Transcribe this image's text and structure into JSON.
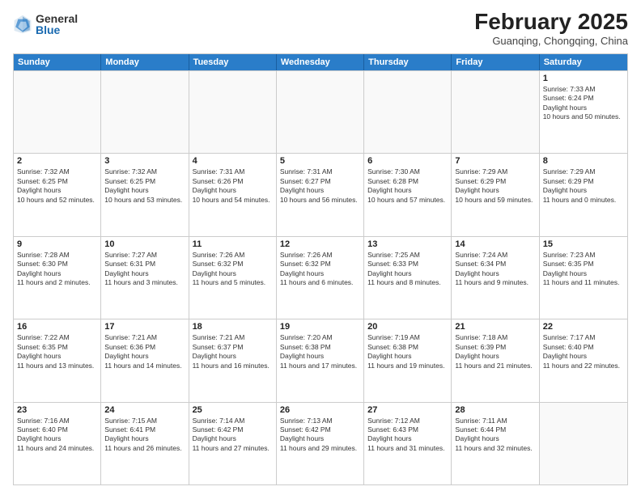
{
  "header": {
    "logo_general": "General",
    "logo_blue": "Blue",
    "main_title": "February 2025",
    "subtitle": "Guanqing, Chongqing, China"
  },
  "weekdays": [
    "Sunday",
    "Monday",
    "Tuesday",
    "Wednesday",
    "Thursday",
    "Friday",
    "Saturday"
  ],
  "weeks": [
    [
      {
        "day": "",
        "empty": true
      },
      {
        "day": "",
        "empty": true
      },
      {
        "day": "",
        "empty": true
      },
      {
        "day": "",
        "empty": true
      },
      {
        "day": "",
        "empty": true
      },
      {
        "day": "",
        "empty": true
      },
      {
        "day": "1",
        "sunrise": "7:33 AM",
        "sunset": "6:24 PM",
        "daylight": "10 hours and 50 minutes."
      }
    ],
    [
      {
        "day": "2",
        "sunrise": "7:32 AM",
        "sunset": "6:25 PM",
        "daylight": "10 hours and 52 minutes."
      },
      {
        "day": "3",
        "sunrise": "7:32 AM",
        "sunset": "6:25 PM",
        "daylight": "10 hours and 53 minutes."
      },
      {
        "day": "4",
        "sunrise": "7:31 AM",
        "sunset": "6:26 PM",
        "daylight": "10 hours and 54 minutes."
      },
      {
        "day": "5",
        "sunrise": "7:31 AM",
        "sunset": "6:27 PM",
        "daylight": "10 hours and 56 minutes."
      },
      {
        "day": "6",
        "sunrise": "7:30 AM",
        "sunset": "6:28 PM",
        "daylight": "10 hours and 57 minutes."
      },
      {
        "day": "7",
        "sunrise": "7:29 AM",
        "sunset": "6:29 PM",
        "daylight": "10 hours and 59 minutes."
      },
      {
        "day": "8",
        "sunrise": "7:29 AM",
        "sunset": "6:29 PM",
        "daylight": "11 hours and 0 minutes."
      }
    ],
    [
      {
        "day": "9",
        "sunrise": "7:28 AM",
        "sunset": "6:30 PM",
        "daylight": "11 hours and 2 minutes."
      },
      {
        "day": "10",
        "sunrise": "7:27 AM",
        "sunset": "6:31 PM",
        "daylight": "11 hours and 3 minutes."
      },
      {
        "day": "11",
        "sunrise": "7:26 AM",
        "sunset": "6:32 PM",
        "daylight": "11 hours and 5 minutes."
      },
      {
        "day": "12",
        "sunrise": "7:26 AM",
        "sunset": "6:32 PM",
        "daylight": "11 hours and 6 minutes."
      },
      {
        "day": "13",
        "sunrise": "7:25 AM",
        "sunset": "6:33 PM",
        "daylight": "11 hours and 8 minutes."
      },
      {
        "day": "14",
        "sunrise": "7:24 AM",
        "sunset": "6:34 PM",
        "daylight": "11 hours and 9 minutes."
      },
      {
        "day": "15",
        "sunrise": "7:23 AM",
        "sunset": "6:35 PM",
        "daylight": "11 hours and 11 minutes."
      }
    ],
    [
      {
        "day": "16",
        "sunrise": "7:22 AM",
        "sunset": "6:35 PM",
        "daylight": "11 hours and 13 minutes."
      },
      {
        "day": "17",
        "sunrise": "7:21 AM",
        "sunset": "6:36 PM",
        "daylight": "11 hours and 14 minutes."
      },
      {
        "day": "18",
        "sunrise": "7:21 AM",
        "sunset": "6:37 PM",
        "daylight": "11 hours and 16 minutes."
      },
      {
        "day": "19",
        "sunrise": "7:20 AM",
        "sunset": "6:38 PM",
        "daylight": "11 hours and 17 minutes."
      },
      {
        "day": "20",
        "sunrise": "7:19 AM",
        "sunset": "6:38 PM",
        "daylight": "11 hours and 19 minutes."
      },
      {
        "day": "21",
        "sunrise": "7:18 AM",
        "sunset": "6:39 PM",
        "daylight": "11 hours and 21 minutes."
      },
      {
        "day": "22",
        "sunrise": "7:17 AM",
        "sunset": "6:40 PM",
        "daylight": "11 hours and 22 minutes."
      }
    ],
    [
      {
        "day": "23",
        "sunrise": "7:16 AM",
        "sunset": "6:40 PM",
        "daylight": "11 hours and 24 minutes."
      },
      {
        "day": "24",
        "sunrise": "7:15 AM",
        "sunset": "6:41 PM",
        "daylight": "11 hours and 26 minutes."
      },
      {
        "day": "25",
        "sunrise": "7:14 AM",
        "sunset": "6:42 PM",
        "daylight": "11 hours and 27 minutes."
      },
      {
        "day": "26",
        "sunrise": "7:13 AM",
        "sunset": "6:42 PM",
        "daylight": "11 hours and 29 minutes."
      },
      {
        "day": "27",
        "sunrise": "7:12 AM",
        "sunset": "6:43 PM",
        "daylight": "11 hours and 31 minutes."
      },
      {
        "day": "28",
        "sunrise": "7:11 AM",
        "sunset": "6:44 PM",
        "daylight": "11 hours and 32 minutes."
      },
      {
        "day": "",
        "empty": true
      }
    ]
  ]
}
